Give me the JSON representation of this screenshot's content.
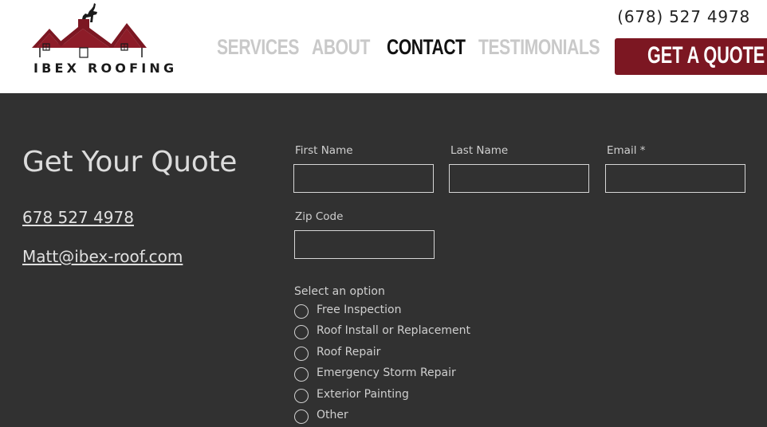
{
  "header": {
    "logo_text": "IBEX ROOFING",
    "nav": [
      {
        "label": "SERVICES",
        "state": "muted"
      },
      {
        "label": "ABOUT",
        "state": "muted"
      },
      {
        "label": "CONTACT",
        "state": "active"
      },
      {
        "label": "TESTIMONIALS",
        "state": "muted"
      }
    ],
    "phone": "(678) 527 4978",
    "cta_label": "GET A QUOTE"
  },
  "left": {
    "title": "Get Your Quote",
    "phone_link": "678 527 4978",
    "email_link": "Matt@ibex-roof.com"
  },
  "form": {
    "first_name": {
      "label": "First Name",
      "value": ""
    },
    "last_name": {
      "label": "Last Name",
      "value": ""
    },
    "email": {
      "label": "Email *",
      "value": ""
    },
    "zip": {
      "label": "Zip Code",
      "value": ""
    },
    "options_label": "Select an option",
    "options": [
      "Free Inspection",
      "Roof Install or Replacement",
      "Roof Repair",
      "Emergency Storm Repair",
      "Exterior Painting",
      "Other"
    ]
  },
  "colors": {
    "brand": "#7c1722",
    "background": "#313131",
    "header_bg": "#ffffff",
    "nav_muted": "#c9c9c9",
    "nav_active": "#111111"
  }
}
